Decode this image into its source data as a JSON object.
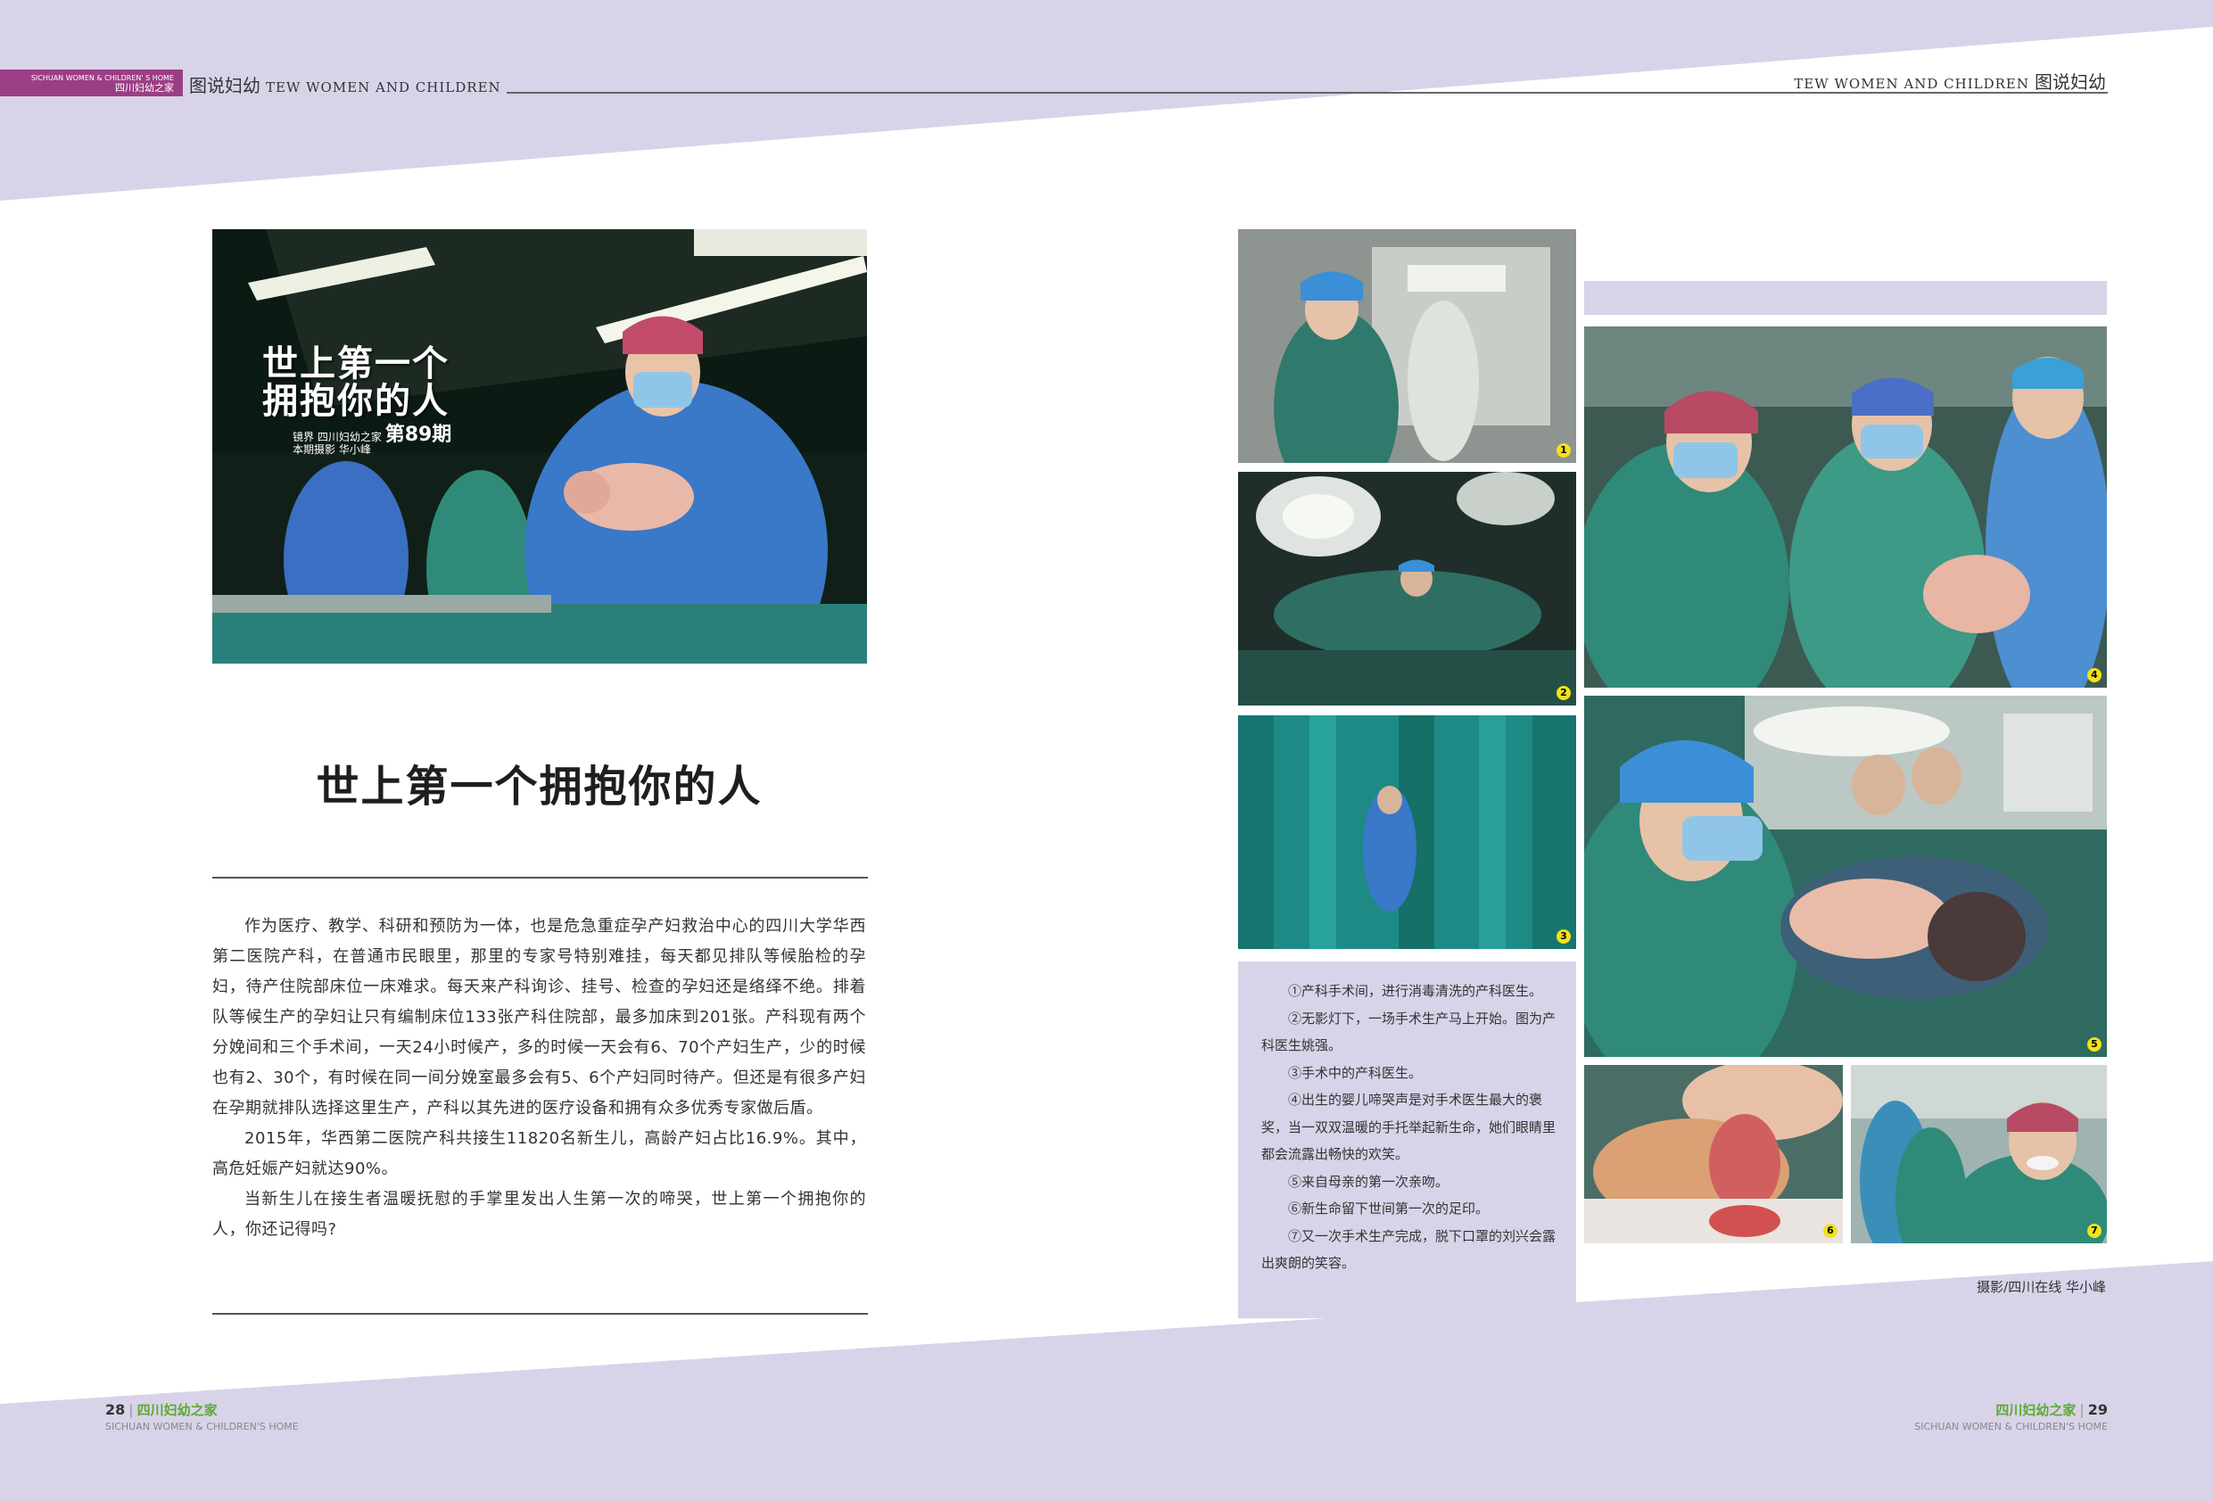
{
  "header": {
    "brand_en": "SICHUAN WOMEN & CHILDREN' S HOME",
    "brand_cn": "四川妇幼之家",
    "left_section_cn": "图说妇幼",
    "left_section_en": "TEW WOMEN AND CHILDREN",
    "right_section_en": "TEW WOMEN AND CHILDREN",
    "right_section_cn": "图说妇幼"
  },
  "hero": {
    "line1": "世上第一个",
    "line2": "拥抱你的人",
    "badge_logo": "镜界",
    "badge_org": "四川妇幼之家",
    "badge_issue": "第89期",
    "badge_credit": "本期摄影 华小峰"
  },
  "article": {
    "title": "世上第一个拥抱你的人",
    "paragraphs": [
      "作为医疗、教学、科研和预防为一体，也是危急重症孕产妇救治中心的四川大学华西第二医院产科，在普通市民眼里，那里的专家号特别难挂，每天都见排队等候胎检的孕妇，待产住院部床位一床难求。每天来产科询诊、挂号、检查的孕妇还是络绎不绝。排着队等候生产的孕妇让只有编制床位133张产科住院部，最多加床到201张。产科现有两个分娩间和三个手术间，一天24小时候产，多的时候一天会有6、70个产妇生产，少的时候也有2、30个，有时候在同一间分娩室最多会有5、6个产妇同时待产。但还是有很多产妇在孕期就排队选择这里生产，产科以其先进的医疗设备和拥有众多优秀专家做后盾。",
      "2015年，华西第二医院产科共接生11820名新生儿，高龄产妇占比16.9%。其中，高危妊娠产妇就达90%。",
      "当新生儿在接生者温暖抚慰的手掌里发出人生第一次的啼哭，世上第一个拥抱你的人，你还记得吗?"
    ]
  },
  "photo_numbers": [
    "1",
    "2",
    "3",
    "4",
    "5",
    "6",
    "7"
  ],
  "captions": [
    "①产科手术间，进行消毒清洗的产科医生。",
    "②无影灯下，一场手术生产马上开始。图为产科医生姚强。",
    "③手术中的产科医生。",
    "④出生的婴儿啼哭声是对手术医生最大的褒奖，当一双双温暖的手托举起新生命，她们眼睛里都会流露出畅快的欢笑。",
    "⑤来自母亲的第一次亲吻。",
    "⑥新生命留下世间第一次的足印。",
    "⑦又一次手术生产完成，脱下口罩的刘兴会露出爽朗的笑容。"
  ],
  "credit": "摄影/四川在线  华小峰",
  "footer_left": {
    "page": "28",
    "name_cn": "四川妇幼之家",
    "name_en": "SICHUAN WOMEN & CHILDREN'S HOME"
  },
  "footer_right": {
    "page": "29",
    "name_cn": "四川妇幼之家",
    "name_en": "SICHUAN WOMEN & CHILDREN'S HOME"
  },
  "colors": {
    "lavender": "#d8d3e8",
    "brand_purple": "#9b3e86",
    "footer_green": "#5caa2e",
    "surgical_teal": "#2f8a7a",
    "surgical_blue": "#3a78c8"
  }
}
